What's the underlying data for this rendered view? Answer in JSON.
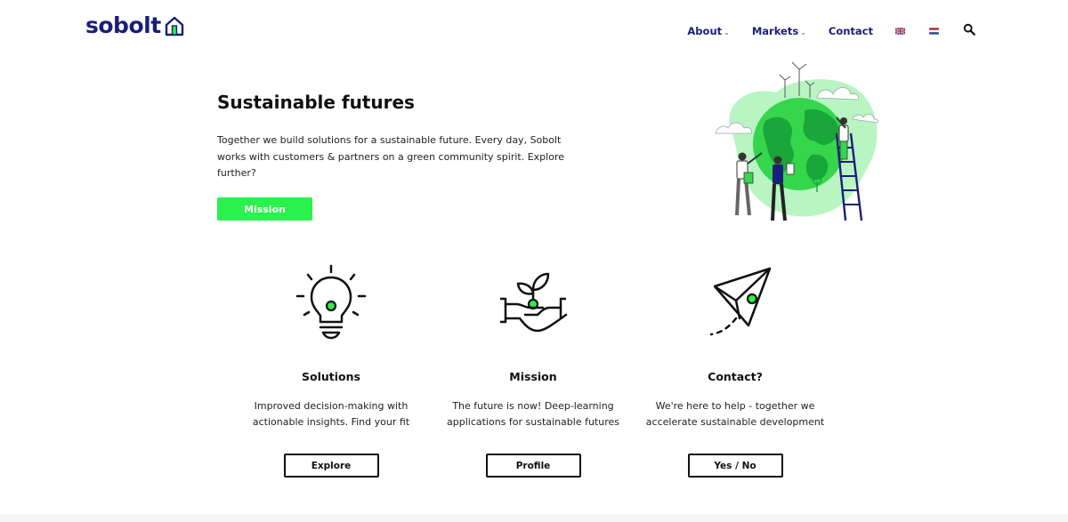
{
  "header": {
    "logo_text": "sobolt",
    "nav": [
      {
        "label": "About",
        "caret": "⌄"
      },
      {
        "label": "Markets",
        "caret": "⌄"
      },
      {
        "label": "Contact"
      }
    ],
    "languages": [
      "English",
      "Nederlands"
    ],
    "search_icon": "search-icon"
  },
  "hero": {
    "title": "Sustainable futures",
    "text": "Together we build solutions for a sustainable future. Every day, Sobolt works with customers & partners on a green community spirit. Explore further?",
    "button": "Mission",
    "illustration": "globe-gardeners-illustration"
  },
  "features": [
    {
      "icon": "lightbulb-icon",
      "title": "Solutions",
      "text": "Improved decision-making with actionable insights. Find your fit",
      "button": "Explore"
    },
    {
      "icon": "plant-in-hand-icon",
      "title": "Mission",
      "text": "The future is now! Deep-learning applications for sustainable futures",
      "button": "Profile"
    },
    {
      "icon": "paper-plane-icon",
      "title": "Contact?",
      "text": "We're here to help - together we accelerate sustainable development",
      "button": "Yes / No"
    }
  ],
  "colors": {
    "brand_navy": "#1a1f7a",
    "brand_green": "#2bf14d",
    "text": "#111111"
  }
}
